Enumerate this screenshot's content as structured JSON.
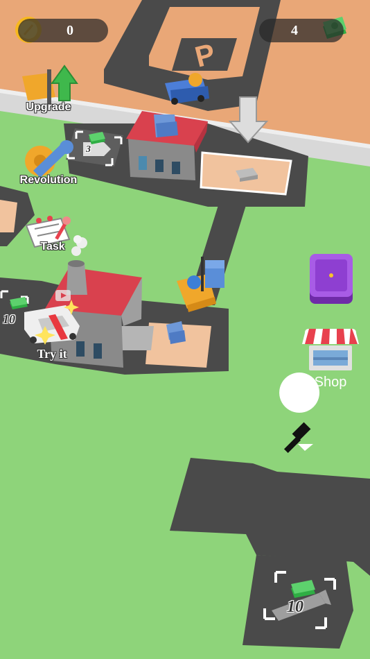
{
  "hud": {
    "coins": "0",
    "cash": "4"
  },
  "side_menu": {
    "upgrade_label": "Upgrade",
    "revolution_label": "Revolution",
    "task_label": "Task",
    "try_it_label": "Try it"
  },
  "right_menu": {
    "shop_label": "Shop"
  },
  "plots": {
    "small_plot_cost": "3",
    "left_plot_cost": "10",
    "bottom_plot_cost": "10"
  },
  "signs": {
    "parking_letter": "P"
  },
  "colors": {
    "grass": "#8ED47A",
    "sand": "#E9A777",
    "road": "#4A4A4A",
    "roof": "#D9414E",
    "accent_purple": "#8E3FD1"
  }
}
